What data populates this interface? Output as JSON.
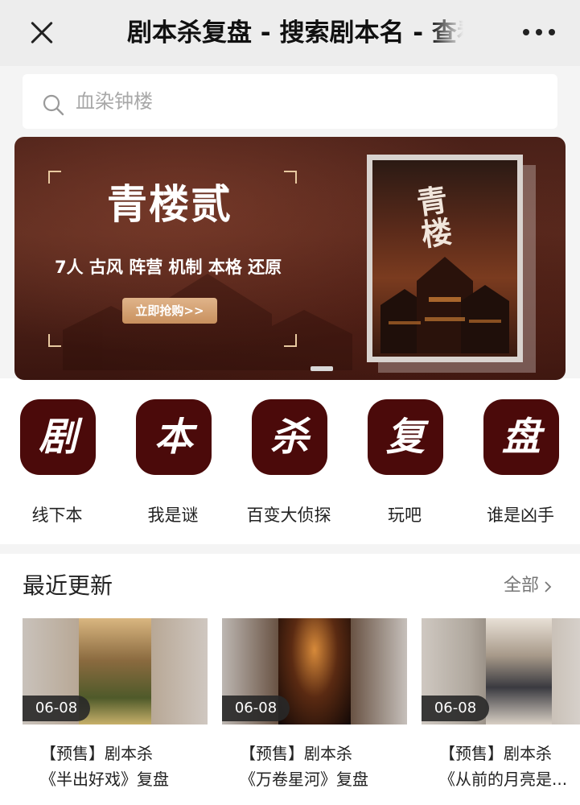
{
  "topbar": {
    "title": "剧本杀复盘 - 搜索剧本名 - 查看",
    "close_icon": "close-icon",
    "more_icon": "more-icon"
  },
  "search": {
    "placeholder": "血染钟楼",
    "icon": "search-icon"
  },
  "banner": {
    "title": "青楼贰",
    "subtitle": "7人 古风 阵营 机制 本格 还原",
    "button_label": "立即抢购>>",
    "poster_title": "青楼"
  },
  "categories": [
    {
      "char": "剧",
      "label": "线下本"
    },
    {
      "char": "本",
      "label": "我是谜"
    },
    {
      "char": "杀",
      "label": "百变大侦探"
    },
    {
      "char": "复",
      "label": "玩吧"
    },
    {
      "char": "盘",
      "label": "谁是凶手"
    }
  ],
  "section": {
    "title": "最近更新",
    "all_label": "全部"
  },
  "cards": [
    {
      "date": "06-08",
      "line1": "【预售】剧本杀",
      "line2": "《半出好戏》复盘"
    },
    {
      "date": "06-08",
      "line1": "【预售】剧本杀",
      "line2": "《万卷星河》复盘"
    },
    {
      "date": "06-08",
      "line1": "【预售】剧本杀",
      "line2": "《从前的月亮是..."
    }
  ],
  "colors": {
    "accent": "#4b0a0a",
    "banner_bg": "#4a2018",
    "button_gold": "#d4a070",
    "page_bg": "#f4f4f4"
  }
}
